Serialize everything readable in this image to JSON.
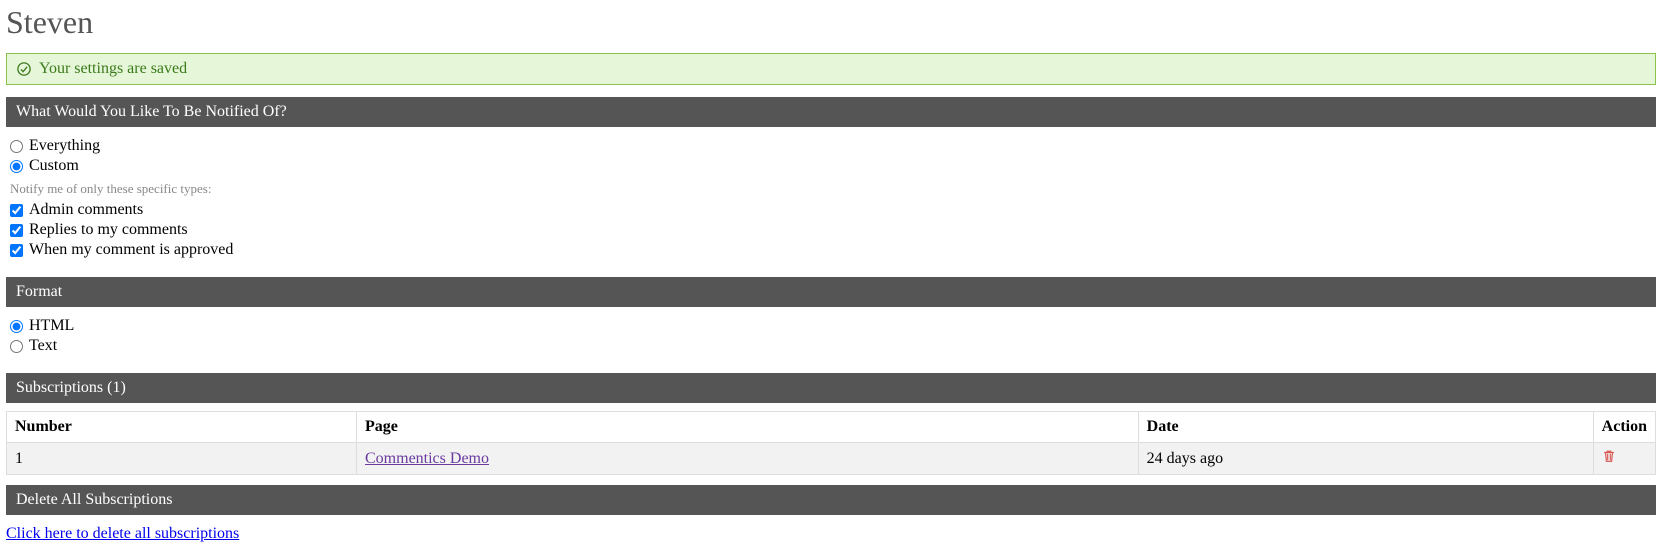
{
  "title": "Steven",
  "alert": {
    "text": "Your settings are saved"
  },
  "sections": {
    "notify": {
      "header": "What Would You Like To Be Notified Of?",
      "options": {
        "everything": "Everything",
        "custom": "Custom"
      },
      "helper": "Notify me of only these specific types:",
      "checks": {
        "admin": "Admin comments",
        "replies": "Replies to my comments",
        "approved": "When my comment is approved"
      }
    },
    "format": {
      "header": "Format",
      "options": {
        "html": "HTML",
        "text": "Text"
      }
    },
    "subscriptions": {
      "header": "Subscriptions (1)",
      "columns": {
        "number": "Number",
        "page": "Page",
        "date": "Date",
        "action": "Action"
      },
      "rows": [
        {
          "number": "1",
          "page": "Commentics Demo",
          "date": "24 days ago"
        }
      ]
    },
    "deleteAll": {
      "header": "Delete All Subscriptions",
      "link": "Click here to delete all subscriptions"
    }
  }
}
